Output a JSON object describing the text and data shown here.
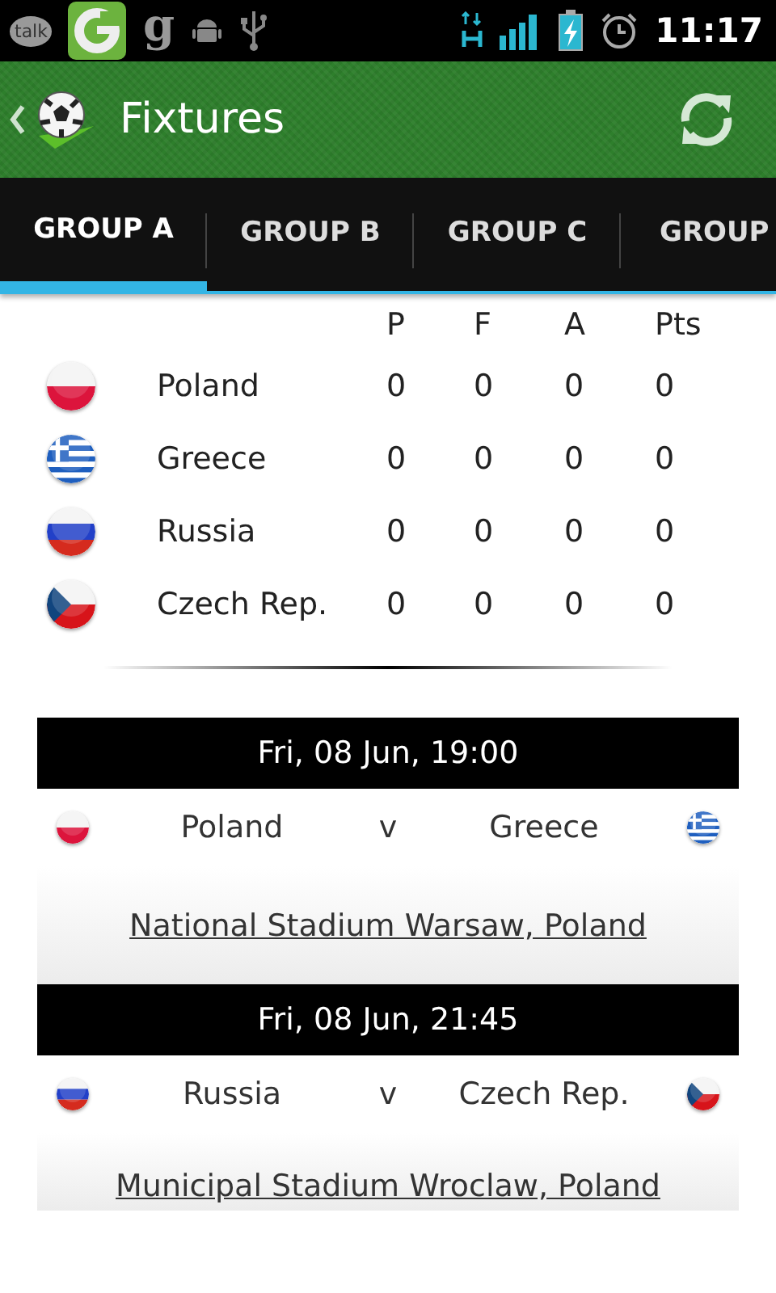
{
  "status_bar": {
    "notifications": [
      {
        "kind": "talk",
        "text": "talk"
      },
      {
        "kind": "app"
      },
      {
        "kind": "letter",
        "text": "g"
      },
      {
        "kind": "android"
      },
      {
        "kind": "usb"
      }
    ],
    "time": "11:17"
  },
  "action_bar": {
    "title": "Fixtures"
  },
  "tabs": [
    {
      "label": "GROUP A",
      "selected": true
    },
    {
      "label": "GROUP B",
      "selected": false
    },
    {
      "label": "GROUP C",
      "selected": false
    },
    {
      "label": "GROUP",
      "selected": false
    }
  ],
  "standings": {
    "columns": [
      "P",
      "F",
      "A",
      "Pts"
    ],
    "rows": [
      {
        "flag": {
          "kind": "poland"
        },
        "team": "Poland",
        "values": [
          "0",
          "0",
          "0",
          "0"
        ]
      },
      {
        "flag": {
          "kind": "greece"
        },
        "team": "Greece",
        "values": [
          "0",
          "0",
          "0",
          "0"
        ]
      },
      {
        "flag": {
          "kind": "russia"
        },
        "team": "Russia",
        "values": [
          "0",
          "0",
          "0",
          "0"
        ]
      },
      {
        "flag": {
          "kind": "czech"
        },
        "team": "Czech Rep.",
        "values": [
          "0",
          "0",
          "0",
          "0"
        ]
      }
    ]
  },
  "fixtures": [
    {
      "date": "Fri, 08 Jun, 19:00",
      "home": {
        "flag": {
          "kind": "poland"
        },
        "team": "Poland"
      },
      "versus": "v",
      "away": {
        "flag": {
          "kind": "greece"
        },
        "team": "Greece"
      },
      "venue": "National Stadium Warsaw, Poland"
    },
    {
      "date": "Fri, 08 Jun, 21:45",
      "home": {
        "flag": {
          "kind": "russia"
        },
        "team": "Russia"
      },
      "versus": "v",
      "away": {
        "flag": {
          "kind": "czech"
        },
        "team": "Czech Rep."
      },
      "venue": "Municipal Stadium Wroclaw, Poland"
    }
  ]
}
